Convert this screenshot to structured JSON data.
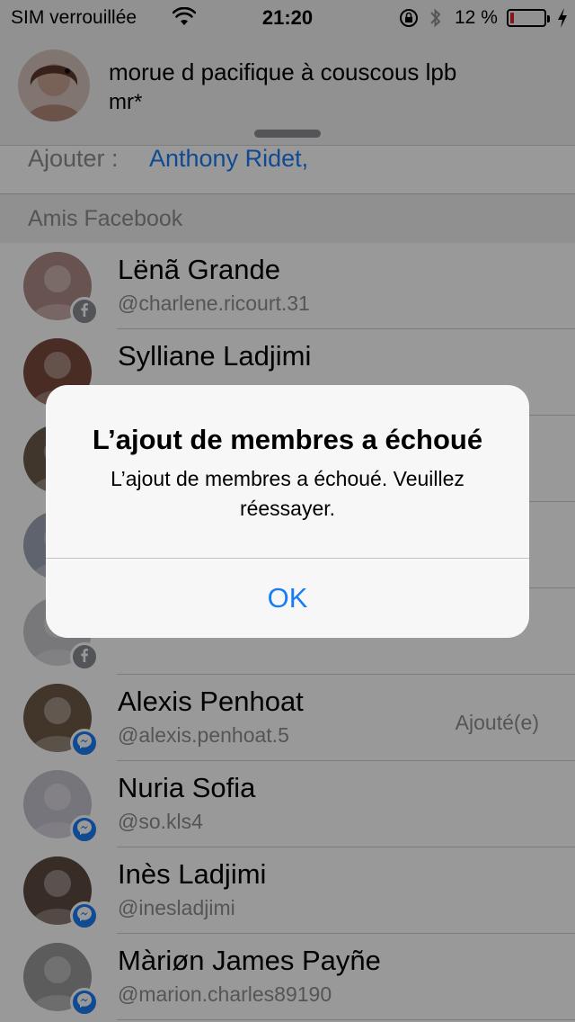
{
  "status_bar": {
    "carrier": "SIM verrouillée",
    "time": "21:20",
    "battery_percent": "12 %",
    "battery_level": 0.12,
    "battery_color": "#e0252a"
  },
  "conversation": {
    "title": "morue d pacifique à couscous lpb",
    "subtitle": "mr*"
  },
  "add_row": {
    "label": "Ajouter :",
    "recipient": "Anthony Ridet,"
  },
  "section_title": "Amis Facebook",
  "contacts": [
    {
      "name": "Lënã Grande",
      "handle": "@charlene.ricourt.31",
      "status": "",
      "badge": "facebook-icon",
      "avatar_color": "#b08a86"
    },
    {
      "name": "Sylliane Ladjimi",
      "handle": "",
      "status": "",
      "badge": "",
      "avatar_color": "#7a4a3c"
    },
    {
      "name": "",
      "handle": "",
      "status": "",
      "badge": "",
      "avatar_color": "#6d5a4a"
    },
    {
      "name": "",
      "handle": "",
      "status": "",
      "badge": "",
      "avatar_color": "#9fa6b6"
    },
    {
      "name": "",
      "handle": "",
      "status": "",
      "badge": "facebook-icon",
      "avatar_color": "#c8c9cd"
    },
    {
      "name": "Alexis Penhoat",
      "handle": "@alexis.penhoat.5",
      "status": "Ajouté(e)",
      "badge": "messenger-icon",
      "avatar_color": "#6e5a48"
    },
    {
      "name": "Nuria Sofia",
      "handle": "@so.kls4",
      "status": "",
      "badge": "messenger-icon",
      "avatar_color": "#c7c3cf"
    },
    {
      "name": "Inès Ladjimi",
      "handle": "@inesladjimi",
      "status": "",
      "badge": "messenger-icon",
      "avatar_color": "#5e4a40"
    },
    {
      "name": "Màriøn James Payñe",
      "handle": "@marion.charles89190",
      "status": "",
      "badge": "messenger-icon",
      "avatar_color": "#9a9a9a"
    }
  ],
  "alert": {
    "title": "L’ajout de membres a échoué",
    "message": "L’ajout de membres a échoué. Veuillez réessayer.",
    "button": "OK"
  },
  "colors": {
    "accent": "#1a7cf5",
    "messenger_badge": "#1a7cf5",
    "facebook_badge": "#8a8d93",
    "secondary_text": "#8e8e93"
  }
}
